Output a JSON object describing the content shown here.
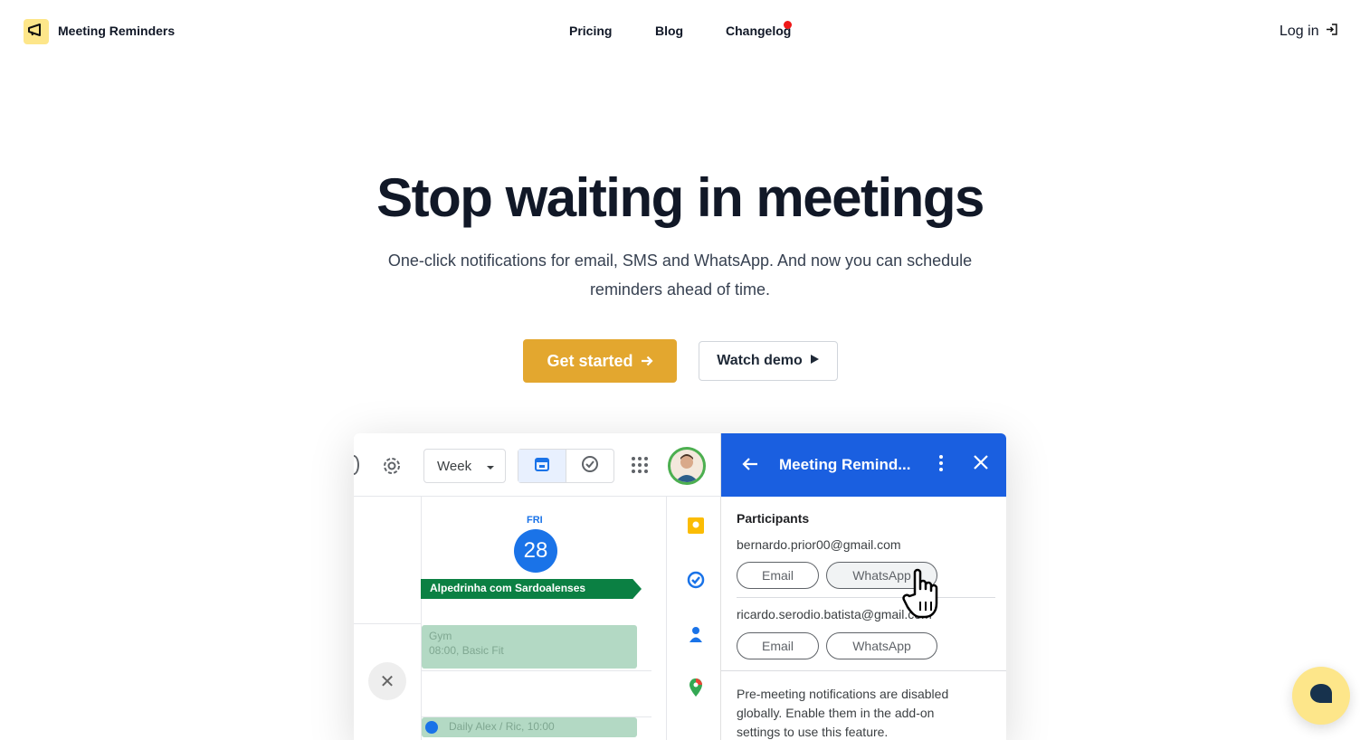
{
  "header": {
    "brand": "Meeting Reminders",
    "nav": [
      {
        "label": "Pricing"
      },
      {
        "label": "Blog"
      },
      {
        "label": "Changelog"
      }
    ],
    "login": "Log in"
  },
  "hero": {
    "title": "Stop waiting in meetings",
    "subtitle": "One-click notifications for email, SMS and WhatsApp. And now you can schedule reminders ahead of time.",
    "primary_cta": "Get started",
    "secondary_cta": "Watch demo"
  },
  "demo": {
    "calendar": {
      "view": "Week",
      "day_name": "FRI",
      "day_number": "28",
      "events": [
        {
          "title": "Alpedrinha com Sardoalenses"
        },
        {
          "title": "Gym",
          "subtitle": "08:00, Basic Fit"
        },
        {
          "title": "Daily Alex / Ric, 10:00"
        }
      ]
    },
    "addon": {
      "title": "Meeting Remind...",
      "participants_heading": "Participants",
      "participants": [
        {
          "email": "bernardo.prior00@gmail.com",
          "email_label": "Email",
          "whatsapp_label": "WhatsApp"
        },
        {
          "email": "ricardo.serodio.batista@gmail.com",
          "email_label": "Email",
          "whatsapp_label": "WhatsApp"
        }
      ],
      "notice": "Pre-meeting notifications are disabled globally. Enable them in the add-on settings to use this feature."
    }
  },
  "colors": {
    "accent": "#e3a72f",
    "logo_bg": "#fde68a",
    "addon_header": "#1a5fe0",
    "calendar_blue": "#1a73e8",
    "event_green": "#0b8043",
    "notification_dot": "#ef1818"
  },
  "icons": {
    "logo": "megaphone-icon",
    "login": "login-icon",
    "cta_arrow": "arrow-right-icon",
    "demo_play": "play-icon",
    "chat": "chat-bubble-icon"
  }
}
